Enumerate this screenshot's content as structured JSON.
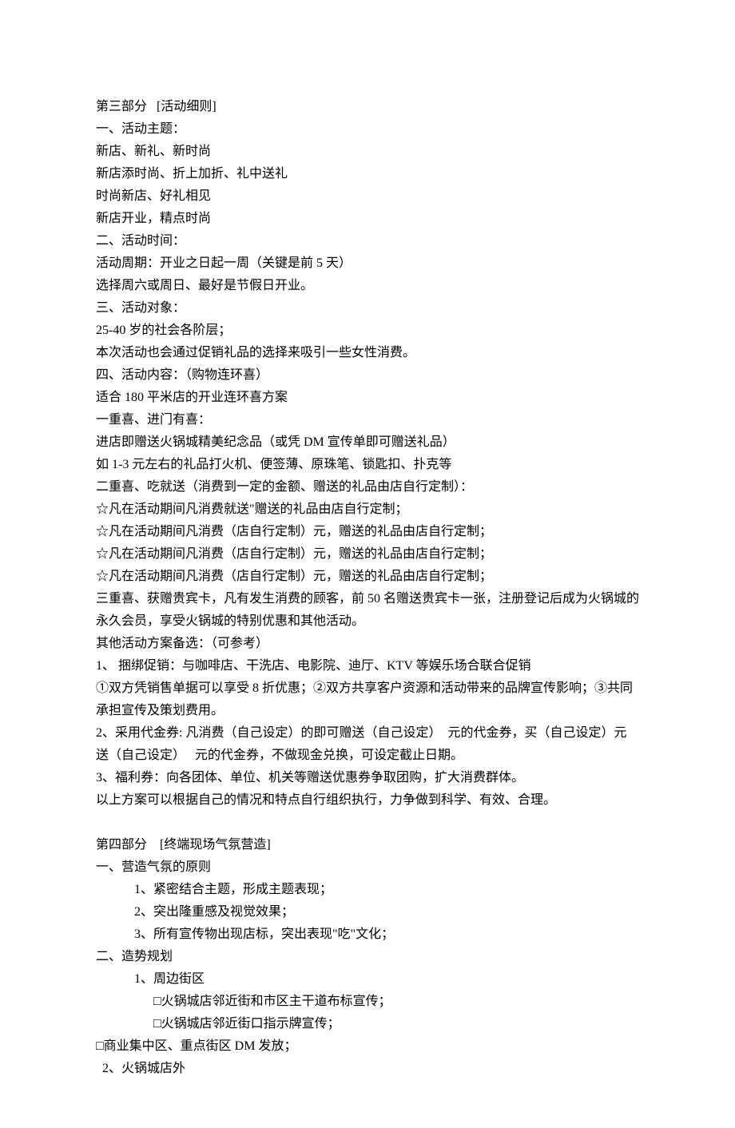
{
  "s3": {
    "title": "第三部分   [活动细则]",
    "a1": "一、活动主题：",
    "a1_l1": "新店、新礼、新时尚",
    "a1_l2": "新店添时尚、折上加折、礼中送礼",
    "a1_l3": "时尚新店、好礼相见",
    "a1_l4": "新店开业，精点时尚",
    "a2": "二、活动时间：",
    "a2_l1": "活动周期：开业之日起一周（关键是前 5 天）",
    "a2_l2": "选择周六或周日、最好是节假日开业。",
    "a3": "三、活动对象：",
    "a3_l1": "25-40 岁的社会各阶层；",
    "a3_l2": "本次活动也会通过促销礼品的选择来吸引一些女性消费。",
    "a4": "四、活动内容：（购物连环喜）",
    "a4_l1": "适合 180 平米店的开业连环喜方案",
    "a4_l2": "一重喜、进门有喜：",
    "a4_l3": "进店即赠送火锅城精美纪念品（或凭 DM 宣传单即可赠送礼品）",
    "a4_l4": "如 1-3 元左右的礼品打火机、便签薄、原珠笔、锁匙扣、扑克等",
    "a4_l5": "二重喜、吃就送（消费到一定的金额、赠送的礼品由店自行定制）：",
    "a4_l6": "☆凡在活动期间凡消费就送\"赠送的礼品由店自行定制；",
    "a4_l7": "☆凡在活动期间凡消费（店自行定制）元，赠送的礼品由店自行定制；",
    "a4_l8": "☆凡在活动期间凡消费（店自行定制）元，赠送的礼品由店自行定制；",
    "a4_l9": "☆凡在活动期间凡消费（店自行定制）元，赠送的礼品由店自行定制；",
    "a4_l10": "三重喜、获赠贵宾卡，凡有发生消费的顾客，前 50 名赠送贵宾卡一张，注册登记后成为火锅城的永久会员，享受火锅城的特别优惠和其他活动。",
    "a4_l11": "其他活动方案备选：（可参考）",
    "a4_l12": "1、 捆绑促销：与咖啡店、干洗店、电影院、迪厅、KTV 等娱乐场合联合促销",
    "a4_l13": "①双方凭销售单据可以享受 8 折优惠；②双方共享客户资源和活动带来的品牌宣传影响；③共同承担宣传及策划费用。",
    "a4_l14": "2、采用代金券: 凡消费（自己设定）的即可赠送（自己设定）  元的代金券，买（自己设定）元送（自己设定）   元的代金券，不做现金兑换，可设定截止日期。",
    "a4_l15": "3、福利券：向各团体、单位、机关等赠送优惠券争取团购，扩大消费群体。",
    "a4_l16": "以上方案可以根据自己的情况和特点自行组织执行，力争做到科学、有效、合理。"
  },
  "s4": {
    "title": "第四部分    [终端现场气氛营造]",
    "b1": "一、营造气氛的原则",
    "b1_l1": "1、紧密结合主题，形成主题表现；",
    "b1_l2": "2、突出隆重感及视觉效果；",
    "b1_l3": "3、所有宣传物出现店标，突出表现\"吃\"文化；",
    "b2": "二、造势规划",
    "b2_l1": "1、周边街区",
    "b2_l2": "□火锅城店邻近街和市区主干道布标宣传；",
    "b2_l3": "□火锅城店邻近街口指示牌宣传；",
    "b2_l4": "□商业集中区、重点街区 DM 发放；",
    "b2_l5": "2、火锅城店外"
  }
}
